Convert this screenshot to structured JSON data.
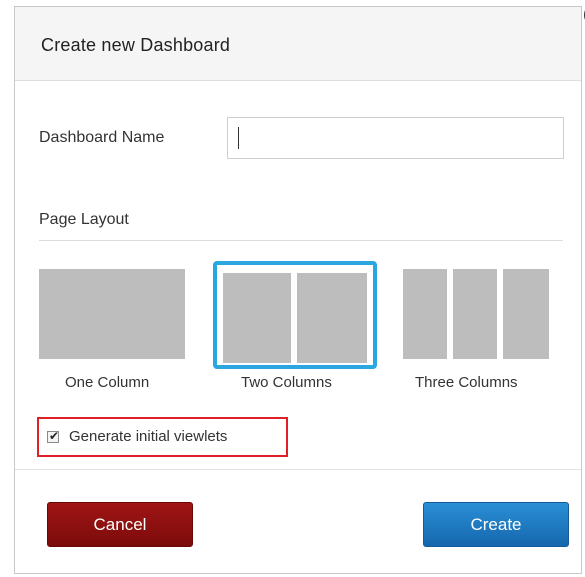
{
  "dialog": {
    "title": "Create new Dashboard"
  },
  "form": {
    "name_label": "Dashboard Name",
    "name_value": "",
    "layout_label": "Page Layout"
  },
  "layout_options": [
    {
      "label": "One Column",
      "selected": false
    },
    {
      "label": "Two Columns",
      "selected": true
    },
    {
      "label": "Three Columns",
      "selected": false
    }
  ],
  "checkbox": {
    "label": "Generate initial viewlets",
    "checked": true
  },
  "buttons": {
    "cancel_label": "Cancel",
    "create_label": "Create"
  },
  "colors": {
    "selected_border": "#2aa6e0",
    "highlight_box": "#e01f26",
    "cancel_bg": "#8f1010",
    "create_bg": "#1f7ac4",
    "thumbnail": "#bdbdbd"
  }
}
